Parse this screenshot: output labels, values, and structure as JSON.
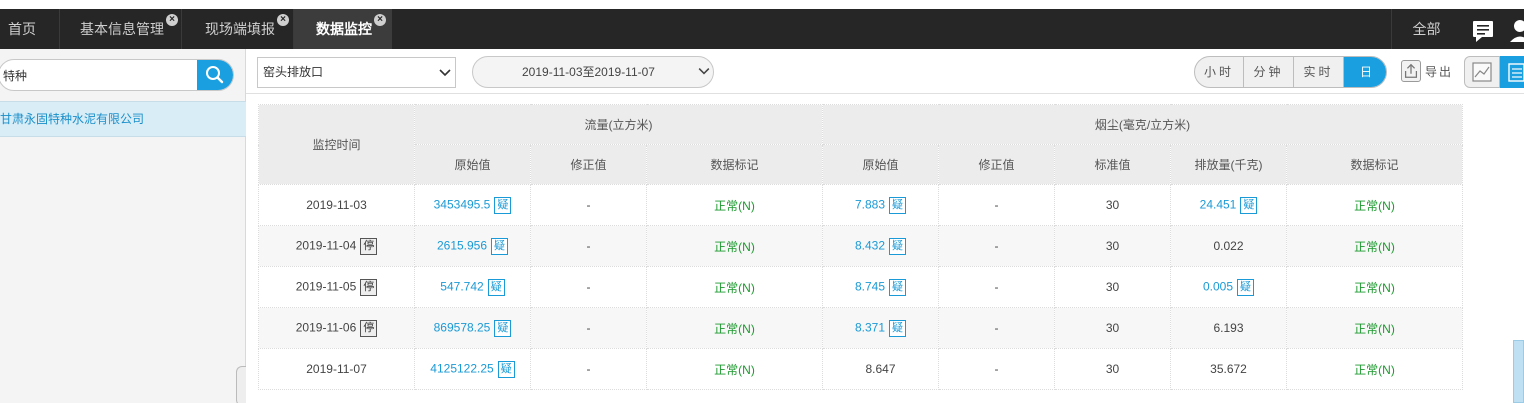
{
  "topbar": {
    "tabs": [
      {
        "label": "首页"
      },
      {
        "label": "基本信息管理"
      },
      {
        "label": "现场端填报"
      },
      {
        "label": "数据监控"
      }
    ],
    "close_glyph": "×",
    "all_label": "全部",
    "icons": [
      "message-icon",
      "user-icon"
    ]
  },
  "sidebar": {
    "search": {
      "value": "特种",
      "icon": "search-icon"
    },
    "company": "甘肃永固特种水泥有限公司"
  },
  "toolbar": {
    "outlet_select": {
      "value": "窑头排放口"
    },
    "date_range": {
      "value": "2019-11-03至2019-11-07"
    },
    "granularity": [
      {
        "label": "小时"
      },
      {
        "label": "分钟"
      },
      {
        "label": "实时"
      },
      {
        "label": "日",
        "active": true
      }
    ],
    "export_label": "导出"
  },
  "table": {
    "col_time": "监控时间",
    "group_flow": "流量(立方米)",
    "group_dust": "烟尘(毫克/立方米)",
    "sub_headers": [
      "原始值",
      "修正值",
      "数据标记",
      "原始值",
      "修正值",
      "标准值",
      "排放量(千克)",
      "数据标记"
    ],
    "tag_doubt": "疑",
    "tag_stop": "停",
    "rows": [
      {
        "date": "2019-11-03",
        "stop": false,
        "flow_raw": "3453495.5",
        "flow_raw_tag": true,
        "flow_fix": "-",
        "flow_mark": "正常(N)",
        "dust_raw": "7.883",
        "dust_raw_tag": true,
        "dust_fix": "-",
        "dust_std": "30",
        "dust_emit": "24.451",
        "dust_emit_tag": true,
        "dust_mark": "正常(N)"
      },
      {
        "date": "2019-11-04",
        "stop": true,
        "flow_raw": "2615.956",
        "flow_raw_tag": true,
        "flow_fix": "-",
        "flow_mark": "正常(N)",
        "dust_raw": "8.432",
        "dust_raw_tag": true,
        "dust_fix": "-",
        "dust_std": "30",
        "dust_emit": "0.022",
        "dust_emit_tag": false,
        "dust_mark": "正常(N)"
      },
      {
        "date": "2019-11-05",
        "stop": true,
        "flow_raw": "547.742",
        "flow_raw_tag": true,
        "flow_fix": "-",
        "flow_mark": "正常(N)",
        "dust_raw": "8.745",
        "dust_raw_tag": true,
        "dust_fix": "-",
        "dust_std": "30",
        "dust_emit": "0.005",
        "dust_emit_tag": true,
        "dust_mark": "正常(N)"
      },
      {
        "date": "2019-11-06",
        "stop": true,
        "flow_raw": "869578.25",
        "flow_raw_tag": true,
        "flow_fix": "-",
        "flow_mark": "正常(N)",
        "dust_raw": "8.371",
        "dust_raw_tag": true,
        "dust_fix": "-",
        "dust_std": "30",
        "dust_emit": "6.193",
        "dust_emit_tag": false,
        "dust_mark": "正常(N)"
      },
      {
        "date": "2019-11-07",
        "stop": false,
        "flow_raw": "4125122.25",
        "flow_raw_tag": true,
        "flow_fix": "-",
        "flow_mark": "正常(N)",
        "dust_raw": "8.647",
        "dust_raw_tag": false,
        "dust_fix": "-",
        "dust_std": "30",
        "dust_emit": "35.672",
        "dust_emit_tag": false,
        "dust_mark": "正常(N)"
      }
    ]
  },
  "colors": {
    "accent": "#1aa0e0",
    "normal": "#1d9a2f",
    "link": "#1a9ad6",
    "topbar": "#262626"
  }
}
